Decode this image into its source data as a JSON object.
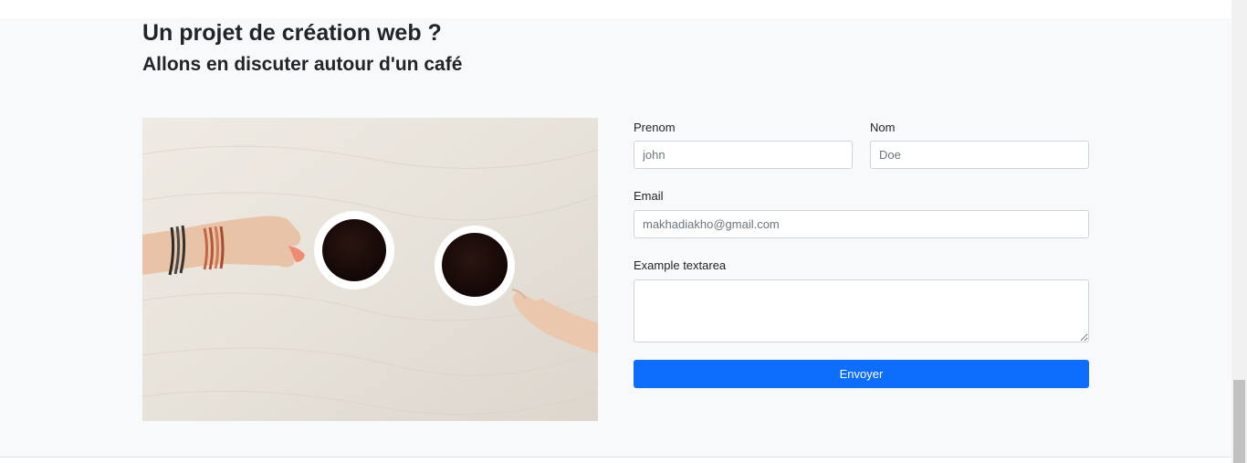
{
  "header": {
    "title": "Un projet de création web ?",
    "subtitle": "Allons en discuter autour d'un café"
  },
  "image": {
    "icon": "coffee-cups-hands-photo"
  },
  "form": {
    "first_name": {
      "label": "Prenom",
      "placeholder": "john"
    },
    "last_name": {
      "label": "Nom",
      "placeholder": "Doe"
    },
    "email": {
      "label": "Email",
      "placeholder": "makhadiakho@gmail.com"
    },
    "message": {
      "label": "Example textarea"
    },
    "submit_label": "Envoyer"
  },
  "colors": {
    "accent": "#0d6efd",
    "section_bg": "#f8f9fa"
  }
}
